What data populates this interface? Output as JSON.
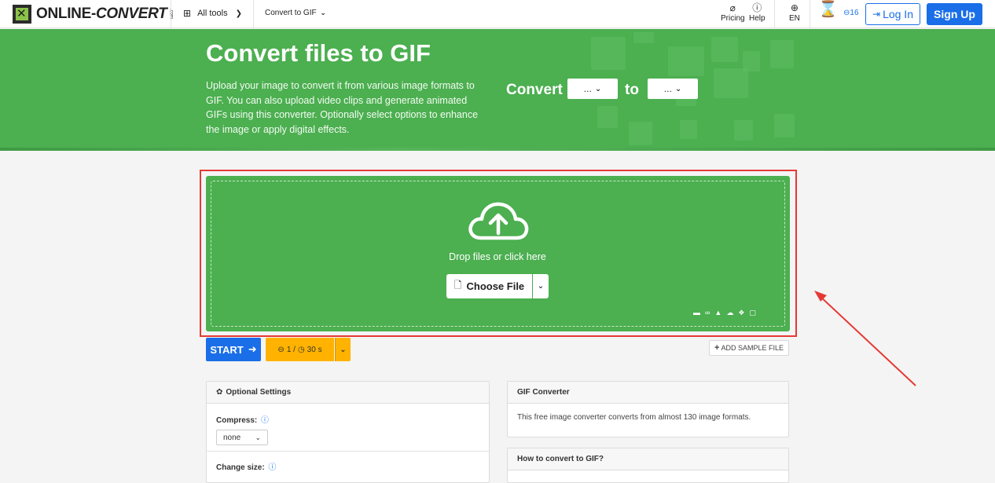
{
  "header": {
    "logo_brand": "ONLINE-",
    "logo_brand2": "CONVERT",
    "logo_dotcom": ".com",
    "all_tools": "All tools",
    "convert_to_gif": "Convert to GIF",
    "pricing": "Pricing",
    "help": "Help",
    "lang": "EN",
    "credits": "16",
    "login": "Log In",
    "signup": "Sign Up"
  },
  "hero": {
    "title": "Convert files to GIF",
    "description": "Upload your image to convert it from various image formats to GIF. You can also upload video clips and generate animated GIFs using this converter. Optionally select options to enhance the image or apply digital effects.",
    "convert_label": "Convert",
    "to_label": "to",
    "from_select": "...",
    "to_select": "..."
  },
  "upload": {
    "drop_text": "Drop files or click here",
    "choose_file": "Choose File"
  },
  "actions": {
    "start": "START",
    "credit_info": "1 /",
    "time_info": "30 s",
    "add_sample": "ADD SAMPLE FILE"
  },
  "optional_settings": {
    "title": "Optional Settings",
    "compress_label": "Compress:",
    "compress_value": "none",
    "change_size_label": "Change size:"
  },
  "gif_converter": {
    "title": "GIF Converter",
    "body": "This free image converter converts from almost 130 image formats."
  },
  "how_to": {
    "title": "How to convert to GIF?"
  },
  "colors": {
    "primary_green": "#4caf50",
    "primary_blue": "#1a6ee8",
    "accent_orange": "#ffb300",
    "annotation_red": "#e53935"
  }
}
